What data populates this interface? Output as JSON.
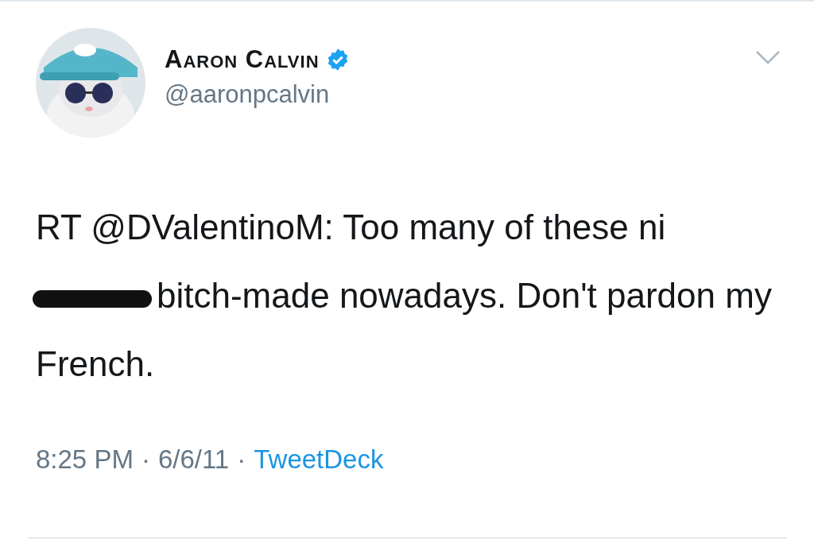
{
  "author": {
    "name": "Aaron Calvin",
    "verified": true,
    "handle": "@aaronpcalvin"
  },
  "tweet": {
    "parts": [
      {
        "kind": "text",
        "text": "RT @DValentinoM: Too many of these ni"
      },
      {
        "kind": "redaction"
      },
      {
        "kind": "text",
        "text": "bitch-made nowadays. Don't pardon my French."
      }
    ]
  },
  "meta": {
    "time": "8:25 PM",
    "separator_1": "·",
    "date": "6/6/11",
    "separator_2": "·",
    "source": "TweetDeck"
  }
}
